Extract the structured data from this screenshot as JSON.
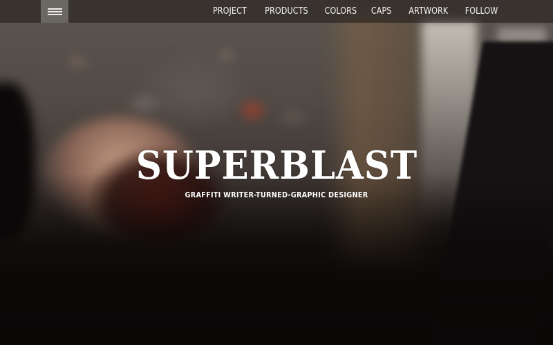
{
  "header": {
    "menu_icon": "hamburger-menu-icon",
    "nav_items": [
      {
        "label": "PROJECT"
      },
      {
        "label": "PRODUCTS"
      },
      {
        "label": "COLORS"
      },
      {
        "label": "CAPS"
      },
      {
        "label": "ARTWORK"
      },
      {
        "label": "FOLLOW"
      }
    ]
  },
  "hero": {
    "logo_text": "SUPERBLAST",
    "tagline": "GRAFFITI WRITER-TURNED-GRAPHIC DESIGNER"
  },
  "colors": {
    "text": "#ffffff",
    "nav_bar_bg": "#1c1816",
    "menu_button_bg": "#96918c"
  }
}
